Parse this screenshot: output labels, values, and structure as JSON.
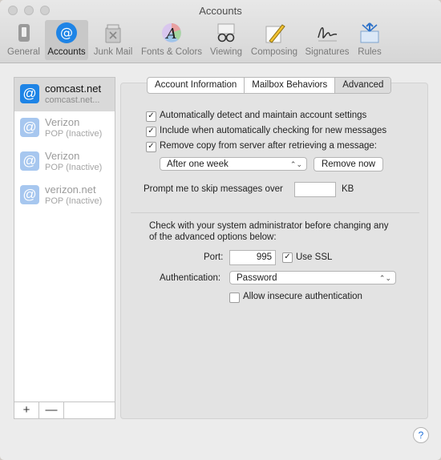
{
  "window": {
    "title": "Accounts"
  },
  "toolbar": {
    "items": [
      {
        "label": "General"
      },
      {
        "label": "Accounts"
      },
      {
        "label": "Junk Mail"
      },
      {
        "label": "Fonts & Colors"
      },
      {
        "label": "Viewing"
      },
      {
        "label": "Composing"
      },
      {
        "label": "Signatures"
      },
      {
        "label": "Rules"
      }
    ],
    "selected": "Accounts"
  },
  "sidebar": {
    "accounts": [
      {
        "name": "comcast.net",
        "subtitle": "comcast.net...",
        "selected": true
      },
      {
        "name": "Verizon",
        "subtitle": "POP (Inactive)",
        "selected": false
      },
      {
        "name": "Verizon",
        "subtitle": "POP (Inactive)",
        "selected": false
      },
      {
        "name": "verizon.net",
        "subtitle": "POP (Inactive)",
        "selected": false
      }
    ],
    "add_label": "+",
    "remove_label": "—"
  },
  "tabs": [
    {
      "label": "Account Information"
    },
    {
      "label": "Mailbox Behaviors"
    },
    {
      "label": "Advanced",
      "active": true
    }
  ],
  "advanced": {
    "auto_detect": {
      "label": "Automatically detect and maintain account settings",
      "checked": true
    },
    "include_checking": {
      "label": "Include when automatically checking for new messages",
      "checked": true
    },
    "remove_copy": {
      "label": "Remove copy from server after retrieving a message:",
      "checked": true
    },
    "remove_after": {
      "value": "After one week"
    },
    "remove_now_label": "Remove now",
    "prompt_skip": {
      "label": "Prompt me to skip messages over",
      "value": "",
      "unit": "KB"
    },
    "admin_note": "Check with your system administrator before changing any of the advanced options below:",
    "port": {
      "label": "Port:",
      "value": "995"
    },
    "use_ssl": {
      "label": "Use SSL",
      "checked": true
    },
    "authentication": {
      "label": "Authentication:",
      "value": "Password"
    },
    "allow_insecure": {
      "label": "Allow insecure authentication",
      "checked": false
    }
  },
  "help_label": "?",
  "colors": {
    "accent": "#1e84e6",
    "panel": "#e3e3e3"
  }
}
